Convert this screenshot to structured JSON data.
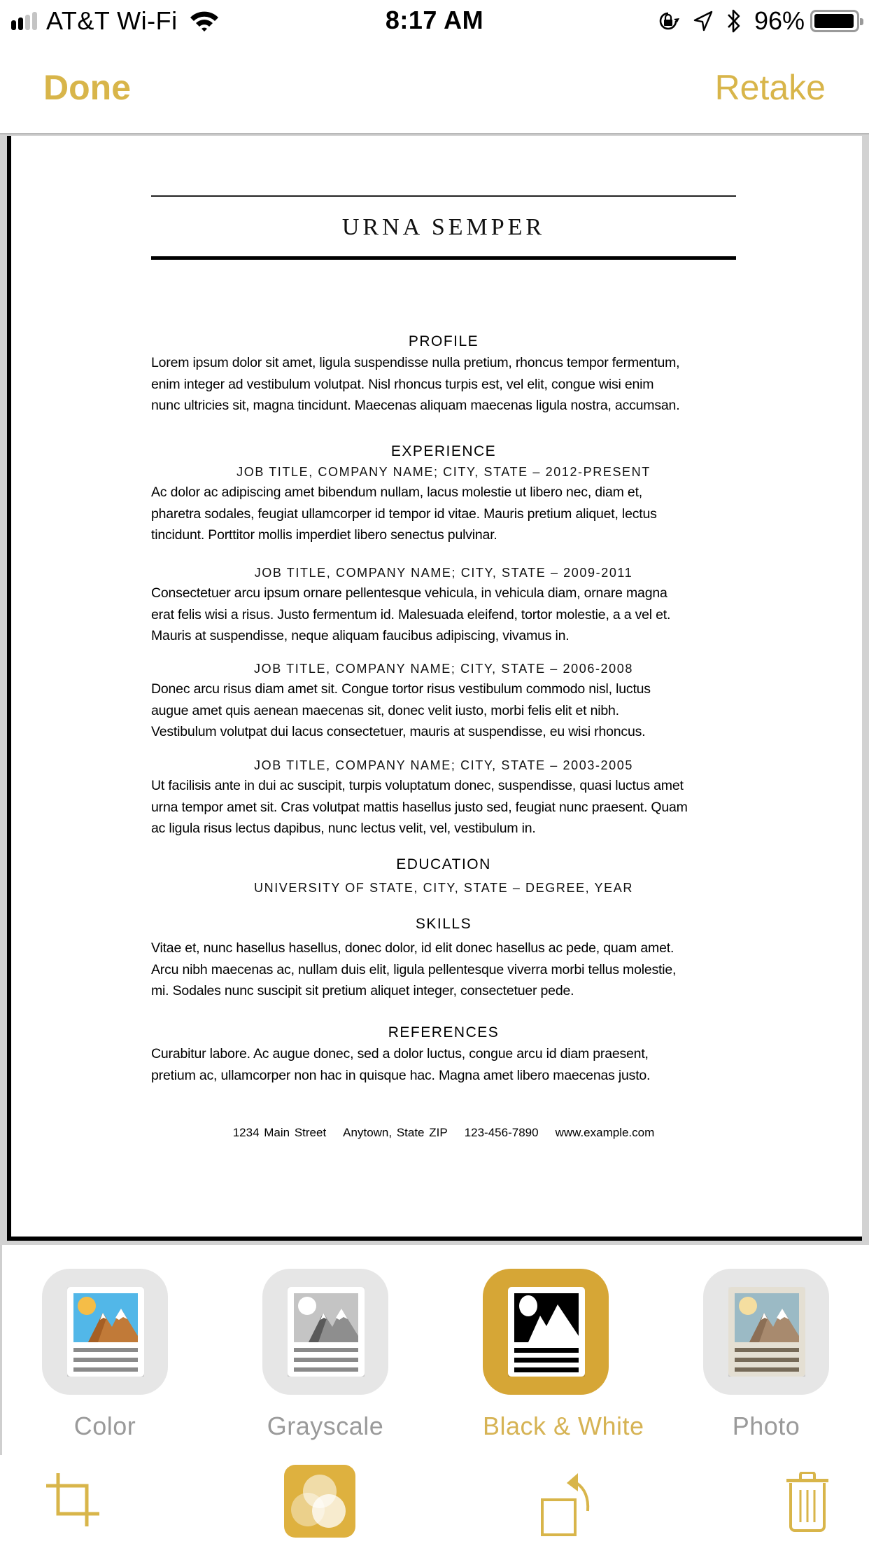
{
  "status_bar": {
    "carrier": "AT&T Wi-Fi",
    "time": "8:17 AM",
    "battery_percent": "96%",
    "battery_level": 0.96,
    "signal_bars_on": 2,
    "signal_bars_total": 4,
    "icons": [
      "signal-icon",
      "wifi-icon",
      "orientation-lock-icon",
      "location-icon",
      "bluetooth-icon",
      "battery-icon"
    ]
  },
  "nav": {
    "done_label": "Done",
    "retake_label": "Retake"
  },
  "document": {
    "name": "URNA SEMPER",
    "sections": {
      "profile": {
        "heading": "PROFILE",
        "lines": [
          "Lorem ipsum dolor sit amet, ligula suspendisse nulla pretium, rhoncus tempor fermentum,",
          "enim integer ad vestibulum volutpat. Nisl rhoncus turpis est, vel elit, congue wisi enim",
          "nunc ultricies sit, magna tincidunt. Maecenas aliquam maecenas ligula nostra, accumsan."
        ]
      },
      "experience": {
        "heading": "EXPERIENCE",
        "jobs": [
          {
            "title": "JOB TITLE, COMPANY NAME; CITY, STATE – 2012-PRESENT",
            "lines": [
              "Ac dolor ac adipiscing amet bibendum nullam, lacus molestie ut libero nec, diam et,",
              "pharetra sodales, feugiat ullamcorper id tempor id vitae. Mauris pretium aliquet, lectus",
              "tincidunt. Porttitor mollis imperdiet libero senectus pulvinar."
            ]
          },
          {
            "title": "JOB TITLE, COMPANY NAME; CITY, STATE – 2009-2011",
            "lines": [
              "Consectetuer arcu ipsum ornare pellentesque vehicula, in vehicula diam, ornare magna",
              "erat felis wisi a risus. Justo fermentum id. Malesuada eleifend, tortor molestie, a a vel et.",
              "Mauris at suspendisse, neque aliquam faucibus adipiscing, vivamus in."
            ]
          },
          {
            "title": "JOB TITLE, COMPANY NAME; CITY, STATE – 2006-2008",
            "lines": [
              "Donec arcu risus diam amet sit. Congue tortor risus vestibulum commodo nisl, luctus",
              "augue amet quis aenean maecenas sit, donec velit iusto, morbi felis elit et nibh.",
              "Vestibulum volutpat dui lacus consectetuer, mauris at suspendisse, eu wisi rhoncus."
            ]
          },
          {
            "title": "JOB TITLE, COMPANY NAME; CITY, STATE – 2003-2005",
            "lines": [
              "Ut facilisis ante in dui ac suscipit, turpis voluptatum donec, suspendisse, quasi luctus amet",
              "urna tempor amet sit. Cras volutpat mattis hasellus justo sed, feugiat nunc praesent. Quam",
              "ac ligula risus lectus dapibus, nunc lectus velit, vel, vestibulum in."
            ]
          }
        ]
      },
      "education": {
        "heading": "EDUCATION",
        "entry": "UNIVERSITY OF STATE, CITY, STATE – DEGREE, YEAR"
      },
      "skills": {
        "heading": "SKILLS",
        "lines": [
          "Vitae et, nunc hasellus hasellus, donec dolor, id elit donec hasellus ac pede, quam amet.",
          "Arcu nibh maecenas ac, nullam duis elit, ligula pellentesque viverra morbi tellus molestie,",
          "mi. Sodales nunc suscipit sit pretium aliquet integer, consectetuer pede."
        ]
      },
      "references": {
        "heading": "REFERENCES",
        "lines": [
          "Curabitur labore. Ac augue donec, sed a dolor luctus, congue arcu id diam praesent,",
          "pretium ac, ullamcorper non hac in quisque hac. Magna amet libero maecenas justo."
        ]
      }
    },
    "footer": {
      "address": "1234 Main Street",
      "city": "Anytown, State ZIP",
      "phone": "123-456-7890",
      "website": "www.example.com"
    }
  },
  "filters": {
    "selected": "Black & White",
    "options": [
      {
        "label": "Color",
        "icon": "color-filter-icon"
      },
      {
        "label": "Grayscale",
        "icon": "grayscale-filter-icon"
      },
      {
        "label": "Black & White",
        "icon": "black-white-filter-icon"
      },
      {
        "label": "Photo",
        "icon": "photo-filter-icon"
      }
    ]
  },
  "toolbar": {
    "items": [
      {
        "name": "crop",
        "icon": "crop-icon"
      },
      {
        "name": "filters",
        "icon": "filters-icon",
        "active": true
      },
      {
        "name": "rotate",
        "icon": "rotate-icon"
      },
      {
        "name": "delete",
        "icon": "trash-icon"
      }
    ]
  },
  "colors": {
    "accent": "#d8b54a",
    "accent_selected_tile": "#d6a636",
    "inactive_label": "#9a9a9a",
    "tile_bg": "#e6e6e6"
  }
}
